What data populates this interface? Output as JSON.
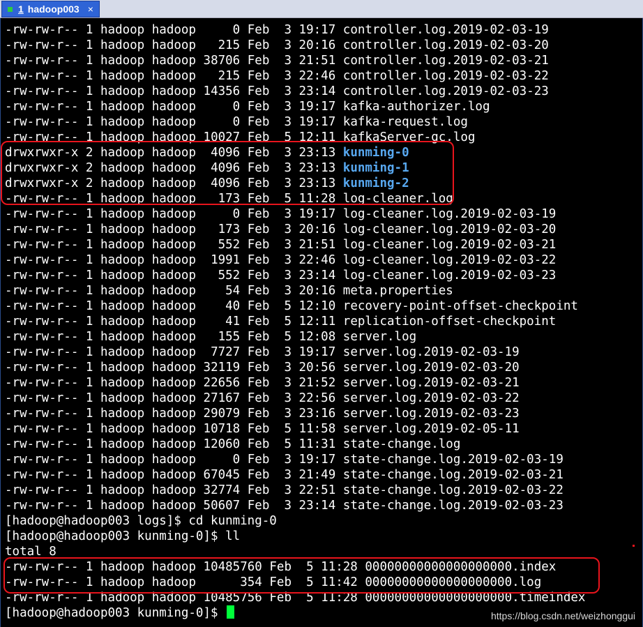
{
  "tab": {
    "number": "1",
    "title": "hadoop003",
    "close": "×"
  },
  "listing": [
    {
      "perm": "-rw-rw-r--",
      "links": "1",
      "user": "hadoop",
      "group": "hadoop",
      "size": "0",
      "month": "Feb",
      "day": "3",
      "time": "19:17",
      "name": "controller.log.2019-02-03-19"
    },
    {
      "perm": "-rw-rw-r--",
      "links": "1",
      "user": "hadoop",
      "group": "hadoop",
      "size": "215",
      "month": "Feb",
      "day": "3",
      "time": "20:16",
      "name": "controller.log.2019-02-03-20"
    },
    {
      "perm": "-rw-rw-r--",
      "links": "1",
      "user": "hadoop",
      "group": "hadoop",
      "size": "38706",
      "month": "Feb",
      "day": "3",
      "time": "21:51",
      "name": "controller.log.2019-02-03-21"
    },
    {
      "perm": "-rw-rw-r--",
      "links": "1",
      "user": "hadoop",
      "group": "hadoop",
      "size": "215",
      "month": "Feb",
      "day": "3",
      "time": "22:46",
      "name": "controller.log.2019-02-03-22"
    },
    {
      "perm": "-rw-rw-r--",
      "links": "1",
      "user": "hadoop",
      "group": "hadoop",
      "size": "14356",
      "month": "Feb",
      "day": "3",
      "time": "23:14",
      "name": "controller.log.2019-02-03-23"
    },
    {
      "perm": "-rw-rw-r--",
      "links": "1",
      "user": "hadoop",
      "group": "hadoop",
      "size": "0",
      "month": "Feb",
      "day": "3",
      "time": "19:17",
      "name": "kafka-authorizer.log"
    },
    {
      "perm": "-rw-rw-r--",
      "links": "1",
      "user": "hadoop",
      "group": "hadoop",
      "size": "0",
      "month": "Feb",
      "day": "3",
      "time": "19:17",
      "name": "kafka-request.log"
    },
    {
      "perm": "-rw-rw-r--",
      "links": "1",
      "user": "hadoop",
      "group": "hadoop",
      "size": "10027",
      "month": "Feb",
      "day": "5",
      "time": "12:11",
      "name": "kafkaServer-gc.log"
    },
    {
      "perm": "drwxrwxr-x",
      "links": "2",
      "user": "hadoop",
      "group": "hadoop",
      "size": "4096",
      "month": "Feb",
      "day": "3",
      "time": "23:13",
      "name": "kunming-0",
      "dir": true
    },
    {
      "perm": "drwxrwxr-x",
      "links": "2",
      "user": "hadoop",
      "group": "hadoop",
      "size": "4096",
      "month": "Feb",
      "day": "3",
      "time": "23:13",
      "name": "kunming-1",
      "dir": true
    },
    {
      "perm": "drwxrwxr-x",
      "links": "2",
      "user": "hadoop",
      "group": "hadoop",
      "size": "4096",
      "month": "Feb",
      "day": "3",
      "time": "23:13",
      "name": "kunming-2",
      "dir": true
    },
    {
      "perm": "-rw-rw-r--",
      "links": "1",
      "user": "hadoop",
      "group": "hadoop",
      "size": "173",
      "month": "Feb",
      "day": "5",
      "time": "11:28",
      "name": "log-cleaner.log"
    },
    {
      "perm": "-rw-rw-r--",
      "links": "1",
      "user": "hadoop",
      "group": "hadoop",
      "size": "0",
      "month": "Feb",
      "day": "3",
      "time": "19:17",
      "name": "log-cleaner.log.2019-02-03-19"
    },
    {
      "perm": "-rw-rw-r--",
      "links": "1",
      "user": "hadoop",
      "group": "hadoop",
      "size": "173",
      "month": "Feb",
      "day": "3",
      "time": "20:16",
      "name": "log-cleaner.log.2019-02-03-20"
    },
    {
      "perm": "-rw-rw-r--",
      "links": "1",
      "user": "hadoop",
      "group": "hadoop",
      "size": "552",
      "month": "Feb",
      "day": "3",
      "time": "21:51",
      "name": "log-cleaner.log.2019-02-03-21"
    },
    {
      "perm": "-rw-rw-r--",
      "links": "1",
      "user": "hadoop",
      "group": "hadoop",
      "size": "1991",
      "month": "Feb",
      "day": "3",
      "time": "22:46",
      "name": "log-cleaner.log.2019-02-03-22"
    },
    {
      "perm": "-rw-rw-r--",
      "links": "1",
      "user": "hadoop",
      "group": "hadoop",
      "size": "552",
      "month": "Feb",
      "day": "3",
      "time": "23:14",
      "name": "log-cleaner.log.2019-02-03-23"
    },
    {
      "perm": "-rw-rw-r--",
      "links": "1",
      "user": "hadoop",
      "group": "hadoop",
      "size": "54",
      "month": "Feb",
      "day": "3",
      "time": "20:16",
      "name": "meta.properties"
    },
    {
      "perm": "-rw-rw-r--",
      "links": "1",
      "user": "hadoop",
      "group": "hadoop",
      "size": "40",
      "month": "Feb",
      "day": "5",
      "time": "12:10",
      "name": "recovery-point-offset-checkpoint"
    },
    {
      "perm": "-rw-rw-r--",
      "links": "1",
      "user": "hadoop",
      "group": "hadoop",
      "size": "41",
      "month": "Feb",
      "day": "5",
      "time": "12:11",
      "name": "replication-offset-checkpoint"
    },
    {
      "perm": "-rw-rw-r--",
      "links": "1",
      "user": "hadoop",
      "group": "hadoop",
      "size": "155",
      "month": "Feb",
      "day": "5",
      "time": "12:08",
      "name": "server.log"
    },
    {
      "perm": "-rw-rw-r--",
      "links": "1",
      "user": "hadoop",
      "group": "hadoop",
      "size": "7727",
      "month": "Feb",
      "day": "3",
      "time": "19:17",
      "name": "server.log.2019-02-03-19"
    },
    {
      "perm": "-rw-rw-r--",
      "links": "1",
      "user": "hadoop",
      "group": "hadoop",
      "size": "32119",
      "month": "Feb",
      "day": "3",
      "time": "20:56",
      "name": "server.log.2019-02-03-20"
    },
    {
      "perm": "-rw-rw-r--",
      "links": "1",
      "user": "hadoop",
      "group": "hadoop",
      "size": "22656",
      "month": "Feb",
      "day": "3",
      "time": "21:52",
      "name": "server.log.2019-02-03-21"
    },
    {
      "perm": "-rw-rw-r--",
      "links": "1",
      "user": "hadoop",
      "group": "hadoop",
      "size": "27167",
      "month": "Feb",
      "day": "3",
      "time": "22:56",
      "name": "server.log.2019-02-03-22"
    },
    {
      "perm": "-rw-rw-r--",
      "links": "1",
      "user": "hadoop",
      "group": "hadoop",
      "size": "29079",
      "month": "Feb",
      "day": "3",
      "time": "23:16",
      "name": "server.log.2019-02-03-23"
    },
    {
      "perm": "-rw-rw-r--",
      "links": "1",
      "user": "hadoop",
      "group": "hadoop",
      "size": "10718",
      "month": "Feb",
      "day": "5",
      "time": "11:58",
      "name": "server.log.2019-02-05-11"
    },
    {
      "perm": "-rw-rw-r--",
      "links": "1",
      "user": "hadoop",
      "group": "hadoop",
      "size": "12060",
      "month": "Feb",
      "day": "5",
      "time": "11:31",
      "name": "state-change.log"
    },
    {
      "perm": "-rw-rw-r--",
      "links": "1",
      "user": "hadoop",
      "group": "hadoop",
      "size": "0",
      "month": "Feb",
      "day": "3",
      "time": "19:17",
      "name": "state-change.log.2019-02-03-19"
    },
    {
      "perm": "-rw-rw-r--",
      "links": "1",
      "user": "hadoop",
      "group": "hadoop",
      "size": "67045",
      "month": "Feb",
      "day": "3",
      "time": "21:49",
      "name": "state-change.log.2019-02-03-21"
    },
    {
      "perm": "-rw-rw-r--",
      "links": "1",
      "user": "hadoop",
      "group": "hadoop",
      "size": "32774",
      "month": "Feb",
      "day": "3",
      "time": "22:51",
      "name": "state-change.log.2019-02-03-22"
    },
    {
      "perm": "-rw-rw-r--",
      "links": "1",
      "user": "hadoop",
      "group": "hadoop",
      "size": "50607",
      "month": "Feb",
      "day": "3",
      "time": "23:14",
      "name": "state-change.log.2019-02-03-23"
    }
  ],
  "commands": {
    "cd": "[hadoop@hadoop003 logs]$ cd kunming-0",
    "ll": "[hadoop@hadoop003 kunming-0]$ ll",
    "total": "total 8",
    "prompt": "[hadoop@hadoop003 kunming-0]$ "
  },
  "listing2": [
    {
      "perm": "-rw-rw-r--",
      "links": "1",
      "user": "hadoop",
      "group": "hadoop",
      "size": "10485760",
      "month": "Feb",
      "day": "5",
      "time": "11:28",
      "name": "00000000000000000000.index"
    },
    {
      "perm": "-rw-rw-r--",
      "links": "1",
      "user": "hadoop",
      "group": "hadoop",
      "size": "354",
      "month": "Feb",
      "day": "5",
      "time": "11:42",
      "name": "00000000000000000000.log"
    },
    {
      "perm": "-rw-rw-r--",
      "links": "1",
      "user": "hadoop",
      "group": "hadoop",
      "size": "10485756",
      "month": "Feb",
      "day": "5",
      "time": "11:28",
      "name": "00000000000000000000.timeindex"
    }
  ],
  "watermark": "https://blog.csdn.net/weizhonggui",
  "colors": {
    "directory": "#58a8f0",
    "highlight": "#e8141c",
    "cursor": "#00ff3a",
    "tab": "#2f64d6"
  }
}
